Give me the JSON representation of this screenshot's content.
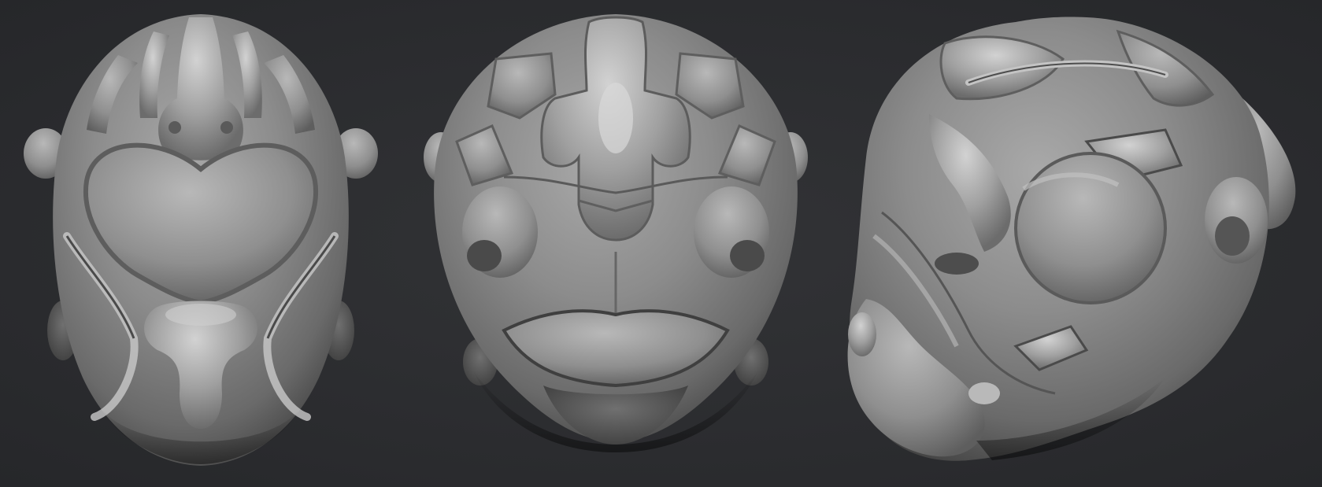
{
  "scene": {
    "background_color": "#2c2d30",
    "material_base": "#8a8a8a",
    "material_highlight": "#c8c8c8",
    "material_shadow": "#3a3a3a"
  },
  "views": [
    {
      "view": "top",
      "subject": "sculpted-helmet-head"
    },
    {
      "view": "front",
      "subject": "sculpted-helmet-head"
    },
    {
      "view": "three-quarter",
      "subject": "sculpted-helmet-head"
    }
  ]
}
